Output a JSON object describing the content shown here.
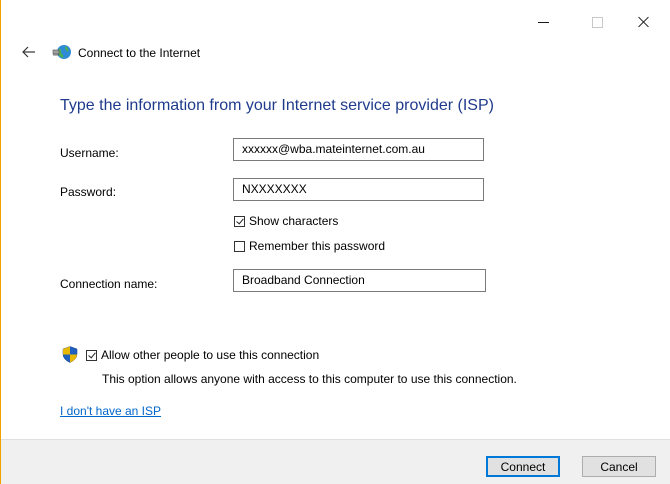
{
  "window": {
    "title": "Connect to the Internet"
  },
  "heading": "Type the information from your Internet service provider (ISP)",
  "form": {
    "username_label": "Username:",
    "username_value": "xxxxxx@wba.mateinternet.com.au",
    "password_label": "Password:",
    "password_value": "NXXXXXXX",
    "show_characters_label": "Show characters",
    "show_characters_checked": true,
    "remember_password_label": "Remember this password",
    "remember_password_checked": false,
    "connection_name_label": "Connection name:",
    "connection_name_value": "Broadband Connection"
  },
  "sharing": {
    "allow_label": "Allow other people to use this connection",
    "allow_checked": true,
    "allow_description": "This option allows anyone with access to this computer to use this connection."
  },
  "links": {
    "no_isp": "I don't have an ISP"
  },
  "buttons": {
    "connect": "Connect",
    "cancel": "Cancel"
  },
  "colors": {
    "heading": "#1f3b8c",
    "link": "#0066cc",
    "default_button_border": "#0078d7",
    "footer_bg": "#f0f0f0"
  },
  "icons": {
    "back": "back-arrow-icon",
    "app": "network-globe-icon",
    "shield": "uac-shield-icon"
  }
}
